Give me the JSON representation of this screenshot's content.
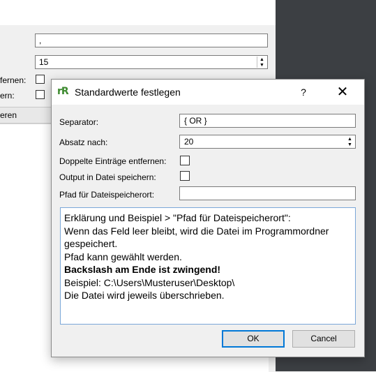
{
  "background_window": {
    "separator_value": ",",
    "absatz_value": "15",
    "label_doppelte_partial": "fernen:",
    "label_output_partial": "ern:",
    "column_header_partial": "eren"
  },
  "dialog": {
    "title": "Standardwerte festlegen",
    "app_icon_text": "rR",
    "help_glyph": "?",
    "close_glyph": "✕",
    "fields": {
      "separator_label": "Separator:",
      "separator_value": "{ OR }",
      "absatz_label": "Absatz nach:",
      "absatz_value": "20",
      "doppelte_label": "Doppelte Einträge entfernen:",
      "output_label": "Output in Datei speichern:",
      "pfad_label": "Pfad für Dateispeicherort:",
      "pfad_value": ""
    },
    "info_lines": [
      "Erklärung und Beispiel > \"Pfad für Dateispeicherort\":",
      "Wenn das Feld leer bleibt, wird die Datei im Programmordner",
      "gespeichert.",
      "Pfad kann gewählt werden.",
      "Backslash am Ende ist zwingend!",
      "Beispiel: C:\\Users\\Musteruser\\Desktop\\",
      "Die Datei wird jeweils überschrieben."
    ],
    "ok_label": "OK",
    "cancel_label": "Cancel"
  },
  "icons": {
    "spin_up": "▲",
    "spin_down": "▼"
  }
}
